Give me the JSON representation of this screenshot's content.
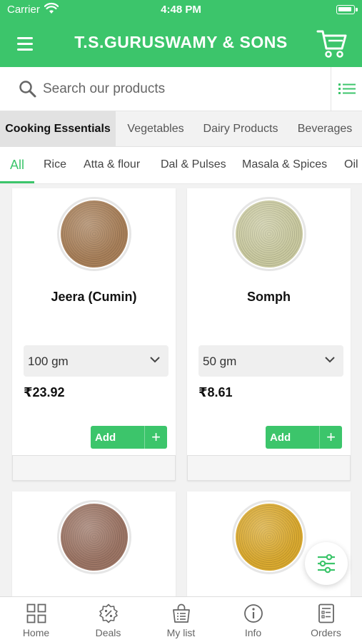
{
  "status_bar": {
    "carrier": "Carrier",
    "time": "4:48 PM"
  },
  "header": {
    "title": "T.S.GURUSWAMY & SONS",
    "menu_icon": "hamburger-icon",
    "cart_icon": "cart-icon"
  },
  "search": {
    "placeholder": "Search our products",
    "value": ""
  },
  "categories": [
    {
      "label": "Cooking Essentials",
      "active": true
    },
    {
      "label": "Vegetables",
      "active": false
    },
    {
      "label": "Dairy Products",
      "active": false
    },
    {
      "label": "Beverages",
      "active": false
    }
  ],
  "subcategories": [
    {
      "label": "All",
      "active": true
    },
    {
      "label": "Rice",
      "active": false
    },
    {
      "label": "Atta & flour",
      "active": false
    },
    {
      "label": "Dal & Pulses",
      "active": false
    },
    {
      "label": "Masala & Spices",
      "active": false
    },
    {
      "label": "Oil",
      "active": false
    }
  ],
  "products": [
    {
      "name": "Jeera (Cumin)",
      "quantity": "100 gm",
      "price": "₹23.92",
      "add_label": "Add",
      "add_icon": "+",
      "color": "#a8805a"
    },
    {
      "name": "Somph",
      "quantity": "50 gm",
      "price": "₹8.61",
      "add_label": "Add",
      "add_icon": "+",
      "color": "#c9c9a0"
    },
    {
      "name": "",
      "quantity": "",
      "price": "",
      "add_label": "",
      "add_icon": "",
      "color": "#9c7565"
    },
    {
      "name": "",
      "quantity": "",
      "price": "",
      "add_label": "",
      "add_icon": "",
      "color": "#d9a930"
    }
  ],
  "tabs": [
    {
      "label": "Home",
      "icon": "grid-icon"
    },
    {
      "label": "Deals",
      "icon": "discount-badge-icon"
    },
    {
      "label": "My list",
      "icon": "shopping-bag-list-icon"
    },
    {
      "label": "Info",
      "icon": "info-icon"
    },
    {
      "label": "Orders",
      "icon": "receipt-icon"
    }
  ],
  "colors": {
    "brand": "#3cc56b",
    "background": "#f2f2f2"
  }
}
